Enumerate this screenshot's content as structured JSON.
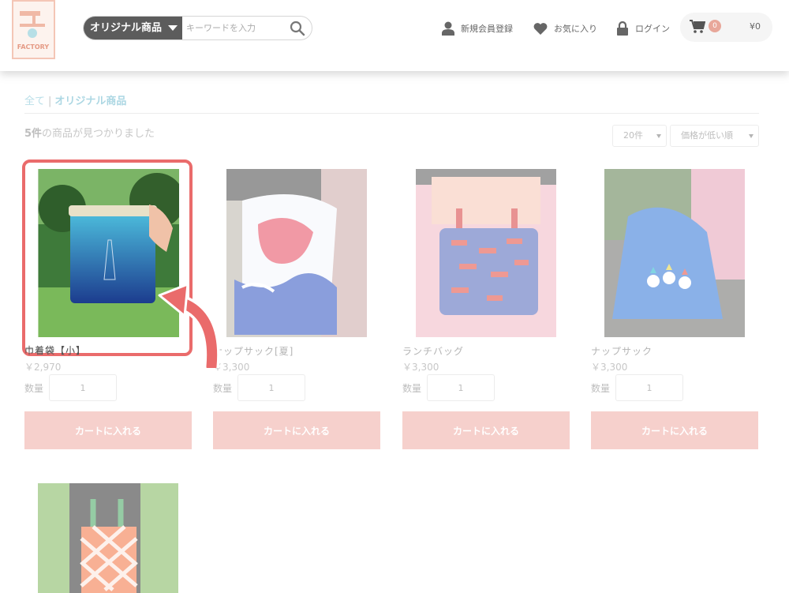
{
  "header": {
    "logo_text": "FACTORY",
    "search": {
      "category": "オリジナル商品",
      "placeholder": "キーワードを入力"
    },
    "nav": {
      "register": "新規会員登録",
      "favorites": "お気に入り",
      "login": "ログイン"
    },
    "cart": {
      "count": "0",
      "total": "¥0"
    }
  },
  "breadcrumb": {
    "all": "全て",
    "separator": "|",
    "current": "オリジナル商品"
  },
  "results": {
    "count": "5件",
    "suffix": "の商品が見つかりました"
  },
  "sort": {
    "per_page": "20件",
    "order": "価格が低い順"
  },
  "products": [
    {
      "name": "巾着袋【小】",
      "price": "￥2,970",
      "qty_label": "数量",
      "qty": "1",
      "button": "カートに入れる"
    },
    {
      "name": "ナップサック[夏]",
      "price": "￥3,300",
      "qty_label": "数量",
      "qty": "1",
      "button": "カートに入れる"
    },
    {
      "name": "ランチバッグ",
      "price": "￥3,300",
      "qty_label": "数量",
      "qty": "1",
      "button": "カートに入れる"
    },
    {
      "name": "ナップサック",
      "price": "￥3,300",
      "qty_label": "数量",
      "qty": "1",
      "button": "カートに入れる"
    },
    {
      "name": "",
      "price": "",
      "qty_label": "",
      "qty": "",
      "button": ""
    }
  ],
  "colors": {
    "accent": "#eeaaa3",
    "highlight": "#ea6b6b",
    "link": "#68b6cc"
  }
}
